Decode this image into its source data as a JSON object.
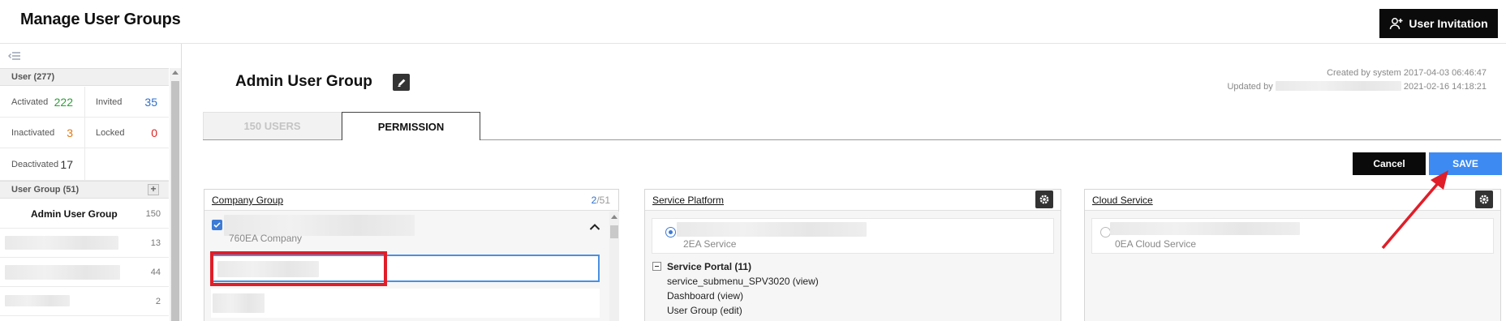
{
  "header": {
    "title": "Manage User Groups",
    "invite_label": "User Invitation",
    "invite_icon": "user-plus-icon"
  },
  "sidebar": {
    "collapse_icon": "collapse-menu-icon",
    "user_section": "User (277)",
    "stats": {
      "activated": {
        "label": "Activated",
        "value": "222",
        "color": "#2e9e3a"
      },
      "invited": {
        "label": "Invited",
        "value": "35",
        "color": "#2d6fcf"
      },
      "inactivated": {
        "label": "Inactivated",
        "value": "3",
        "color": "#e07b18"
      },
      "locked": {
        "label": "Locked",
        "value": "0",
        "color": "#e02020"
      },
      "deactivated": {
        "label": "Deactivated",
        "value": "17",
        "color": "#333333"
      }
    },
    "group_section": "User Group (51)",
    "add_icon": "+",
    "groups": [
      {
        "name": "Admin User Group",
        "count": "150"
      },
      {
        "name": "",
        "count": "13"
      },
      {
        "name": "",
        "count": "44"
      },
      {
        "name": "",
        "count": "2"
      }
    ]
  },
  "main": {
    "group_title": "Admin User Group",
    "created": "Created by system 2017-04-03 06:46:47",
    "updated_prefix": "Updated by",
    "updated_time": "2021-02-16 14:18:21",
    "tabs": [
      {
        "label": "150 USERS",
        "active": false
      },
      {
        "label": "PERMISSION",
        "active": true
      }
    ],
    "cancel_label": "Cancel",
    "save_label": "SAVE",
    "accent_color": "#3d8bf2"
  },
  "panels": {
    "company_group": {
      "title": "Company Group",
      "count_selected": "2",
      "count_total": "/51",
      "item_sub": "760EA Company"
    },
    "service_platform": {
      "title": "Service Platform",
      "item_sub": "2EA Service",
      "tree": {
        "parent": "Service Portal (11)",
        "children": [
          "service_submenu_SPV3020 (view)",
          "Dashboard (view)",
          "User Group (edit)"
        ]
      }
    },
    "cloud_service": {
      "title": "Cloud Service",
      "item_sub": "0EA Cloud Service"
    }
  }
}
